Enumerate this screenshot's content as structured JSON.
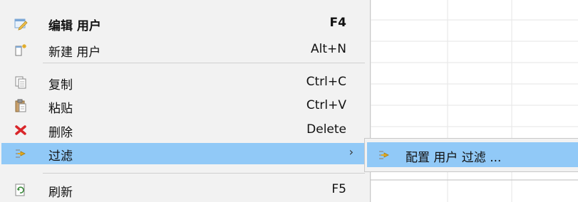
{
  "context_menu": {
    "items": [
      {
        "icon": "edit-icon",
        "label": "编辑 用户",
        "shortcut": "F4",
        "bold": true
      },
      {
        "icon": "new-icon",
        "label": "新建 用户",
        "shortcut": "Alt+N",
        "bold": false
      },
      {
        "icon": "copy-icon",
        "label": "复制",
        "shortcut": "Ctrl+C",
        "bold": false
      },
      {
        "icon": "paste-icon",
        "label": "粘贴",
        "shortcut": "Ctrl+V",
        "bold": false
      },
      {
        "icon": "delete-icon",
        "label": "删除",
        "shortcut": "Delete",
        "bold": false
      },
      {
        "icon": "filter-icon",
        "label": "过滤",
        "shortcut": "",
        "submenu_arrow": "›",
        "bold": false
      },
      {
        "icon": "refresh-icon",
        "label": "刷新",
        "shortcut": "F5",
        "bold": false
      }
    ]
  },
  "filter_submenu": {
    "items": [
      {
        "icon": "filter-icon",
        "label": "配置 用户 过滤 ..."
      }
    ]
  },
  "colors": {
    "highlight": "#91c9f7",
    "menu_bg": "#f2f2f2",
    "delete_red": "#d9262a"
  }
}
